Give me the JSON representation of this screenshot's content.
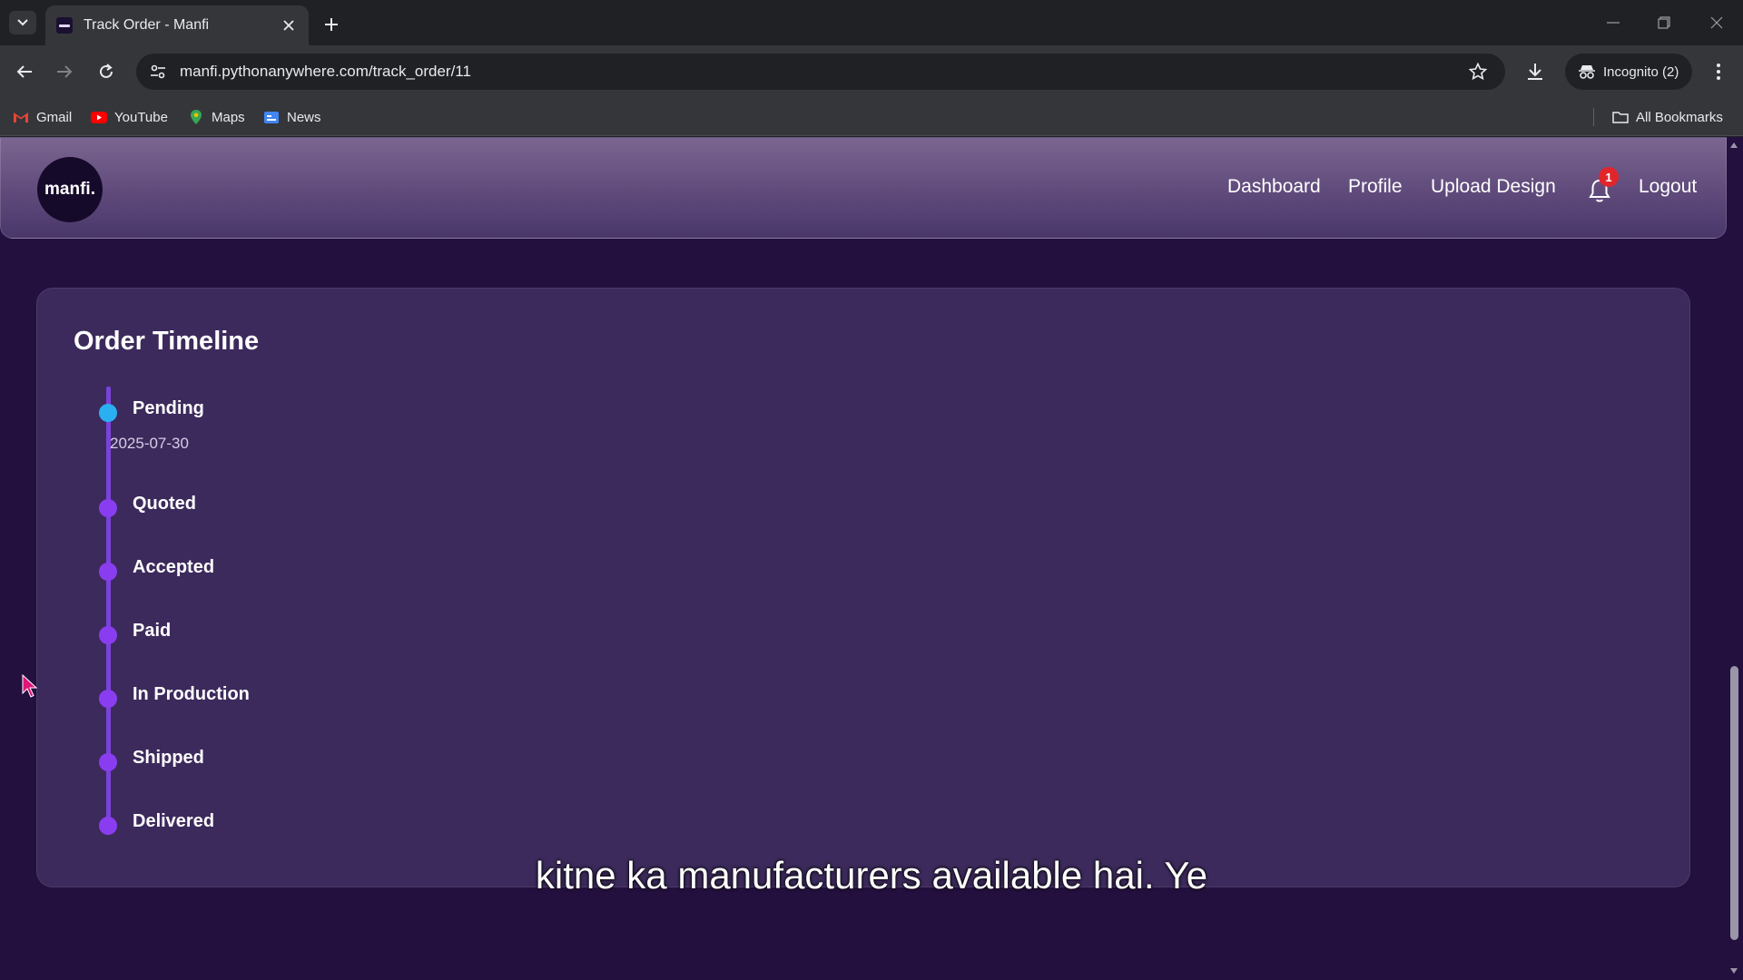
{
  "browser": {
    "tab_title": "Track Order - Manfi",
    "url": "manfi.pythonanywhere.com/track_order/11",
    "incognito_label": "Incognito (2)",
    "bookmarks": [
      {
        "label": "Gmail",
        "icon": "gmail-icon"
      },
      {
        "label": "YouTube",
        "icon": "youtube-icon"
      },
      {
        "label": "Maps",
        "icon": "maps-icon"
      },
      {
        "label": "News",
        "icon": "news-icon"
      }
    ],
    "all_bookmarks_label": "All Bookmarks"
  },
  "site": {
    "logo_text": "manfi.",
    "nav": {
      "dashboard": "Dashboard",
      "profile": "Profile",
      "upload_design": "Upload Design",
      "logout": "Logout"
    },
    "notification_count": "1"
  },
  "timeline": {
    "title": "Order Timeline",
    "steps": [
      {
        "label": "Pending",
        "date": "2025-07-30",
        "active": true
      },
      {
        "label": "Quoted"
      },
      {
        "label": "Accepted"
      },
      {
        "label": "Paid"
      },
      {
        "label": "In Production"
      },
      {
        "label": "Shipped"
      },
      {
        "label": "Delivered"
      }
    ]
  },
  "caption": "kitne ka manufacturers available hai. Ye",
  "colors": {
    "page_bg": "#24103f",
    "card_bg": "#3c2a5c",
    "timeline_line": "#7a43d8",
    "step_dot": "#8a3df0",
    "active_dot": "#2ab0f0",
    "badge": "#e0262b"
  }
}
